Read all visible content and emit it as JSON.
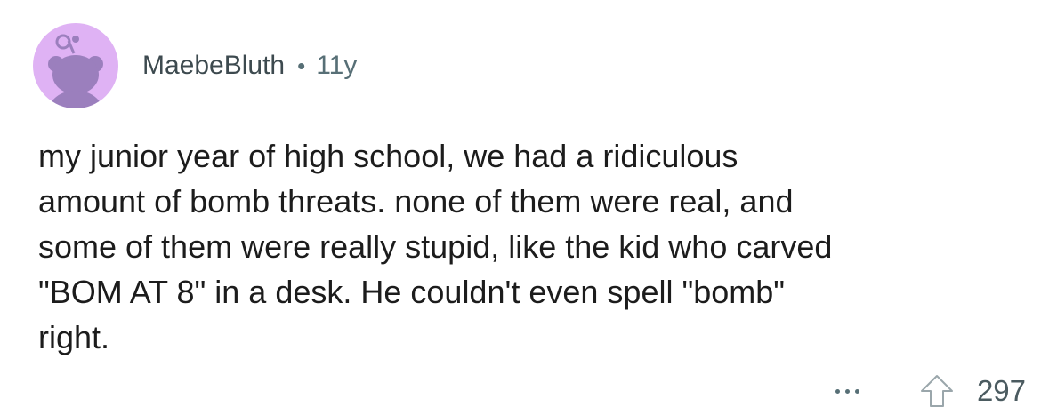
{
  "comment": {
    "author": "MaebeBluth",
    "separator": "•",
    "age": "11y",
    "body": "my junior year of high school, we had a ridiculous\namount of bomb threats. none of them were real, and\nsome of them were really stupid, like the kid who carved\n\"BOM AT 8\" in a desk. He couldn't even spell \"bomb\"\nright.",
    "score": "297",
    "avatar_icon": "reddit-snoo-avatar-icon",
    "more_icon": "ellipsis-icon",
    "upvote_icon": "upvote-arrow-icon"
  },
  "colors": {
    "avatar_bg": "#dfb2f4",
    "avatar_figure": "#9b7fbd",
    "meta_text": "#576f76",
    "body_text": "#1c1c1c"
  }
}
